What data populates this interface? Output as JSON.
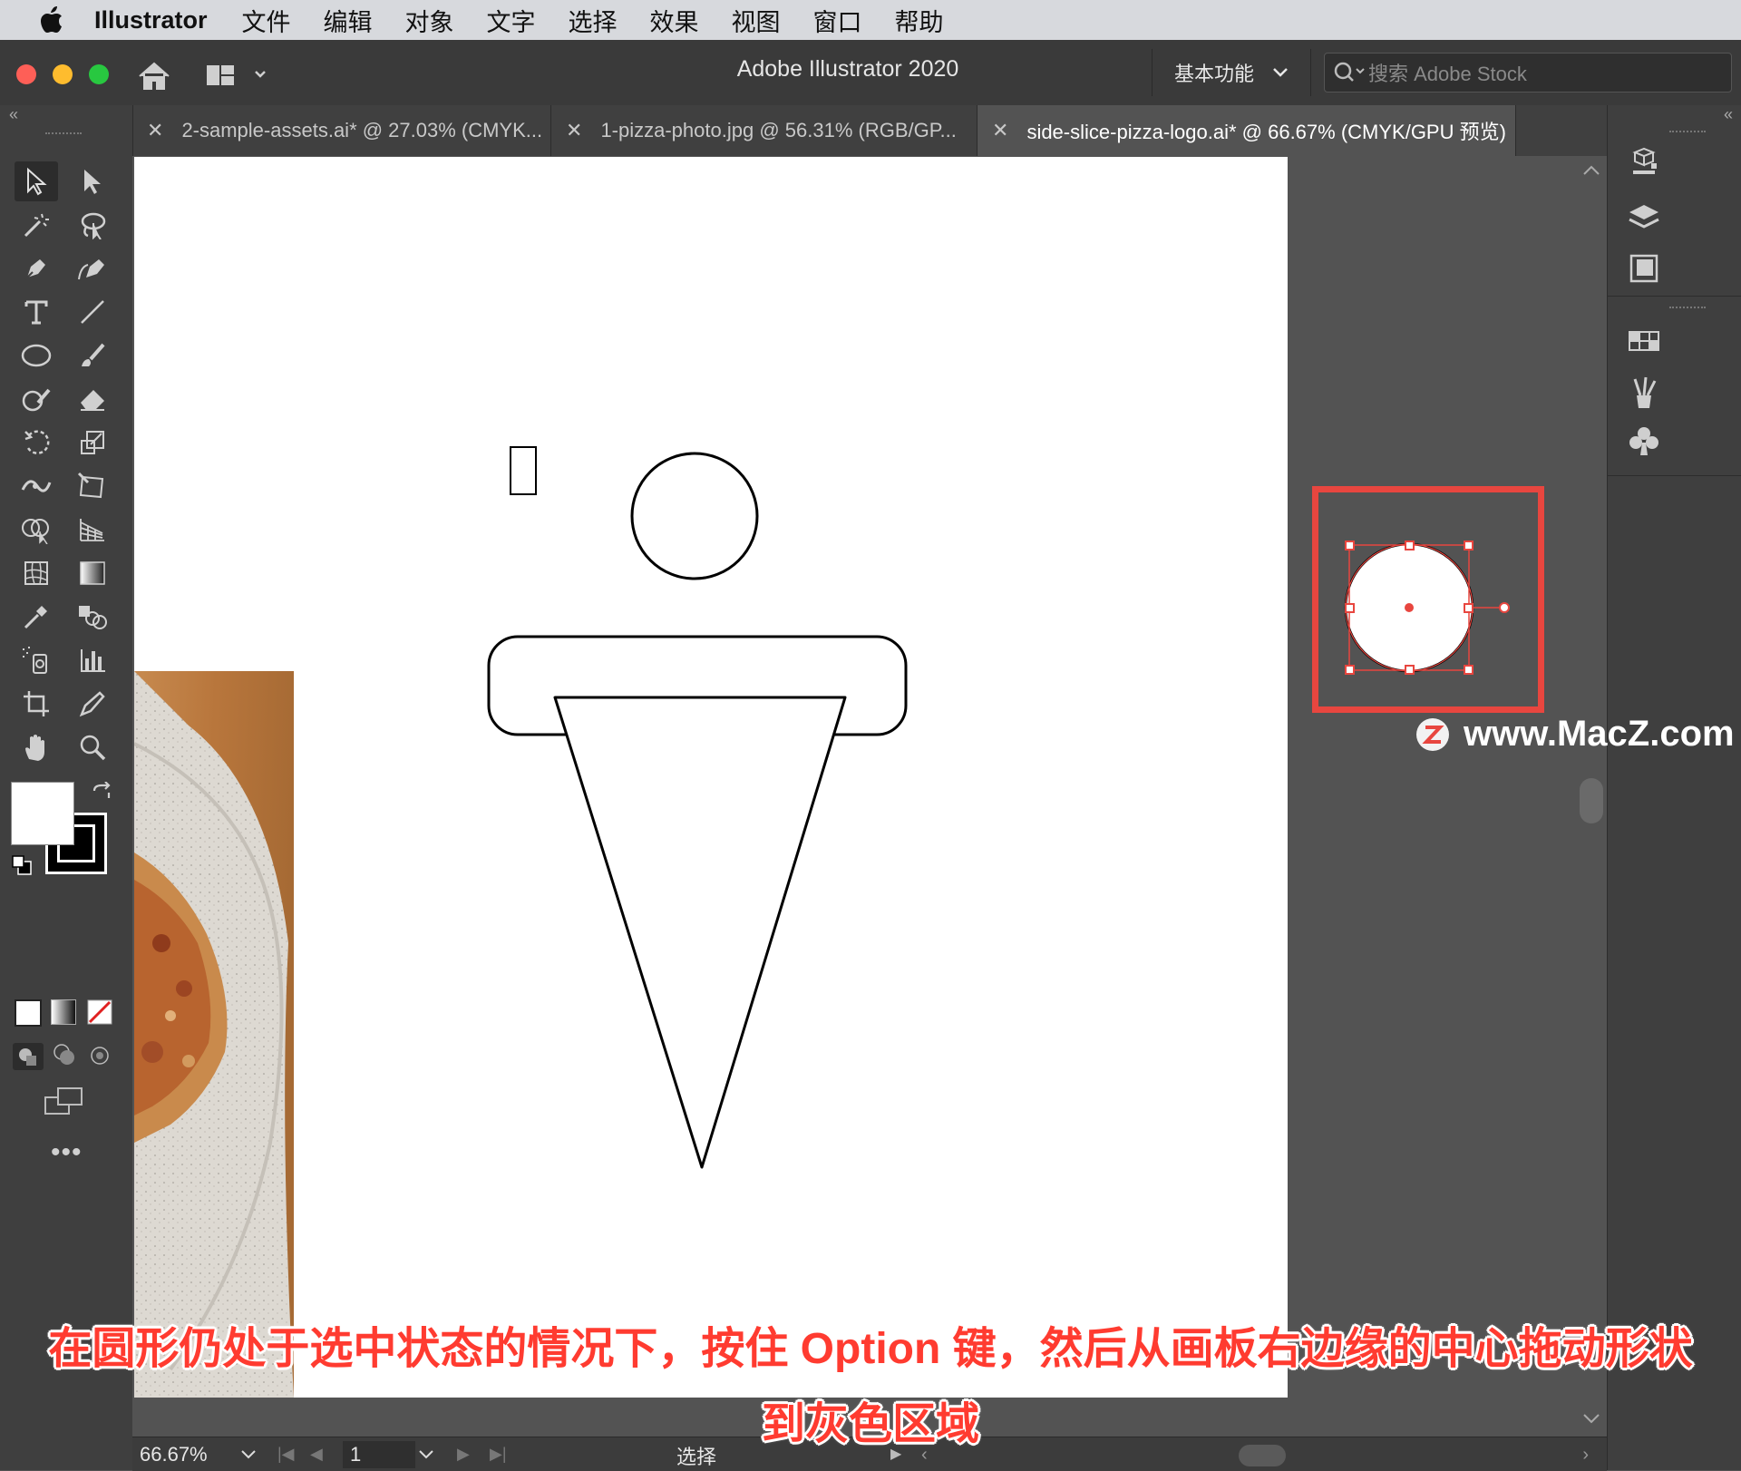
{
  "menubar": {
    "app_name": "Illustrator",
    "items": [
      "文件",
      "编辑",
      "对象",
      "文字",
      "选择",
      "效果",
      "视图",
      "窗口",
      "帮助"
    ]
  },
  "titlebar": {
    "title": "Adobe Illustrator 2020",
    "workspace": "基本功能",
    "stock_placeholder": "搜索 Adobe Stock"
  },
  "tabs": [
    {
      "label": "2-sample-assets.ai* @ 27.03% (CMYK...",
      "active": false
    },
    {
      "label": "1-pizza-photo.jpg @ 56.31% (RGB/GP...",
      "active": false
    },
    {
      "label": "side-slice-pizza-logo.ai* @ 66.67% (CMYK/GPU 预览)",
      "active": true
    }
  ],
  "statusbar": {
    "zoom": "66.67%",
    "artboard_number": "1",
    "current_tool": "选择"
  },
  "caption": {
    "line1": "在圆形仍处于选中状态的情况下，按住 Option 键，然后从画板右边缘的中心拖动形状",
    "line2": "到灰色区域"
  },
  "watermark": "www.MacZ.com",
  "colors": {
    "highlight_box": "#e8463f",
    "selection": "#e8463f",
    "canvas_bg": "#535353",
    "panel_bg": "#3f3f3f"
  }
}
